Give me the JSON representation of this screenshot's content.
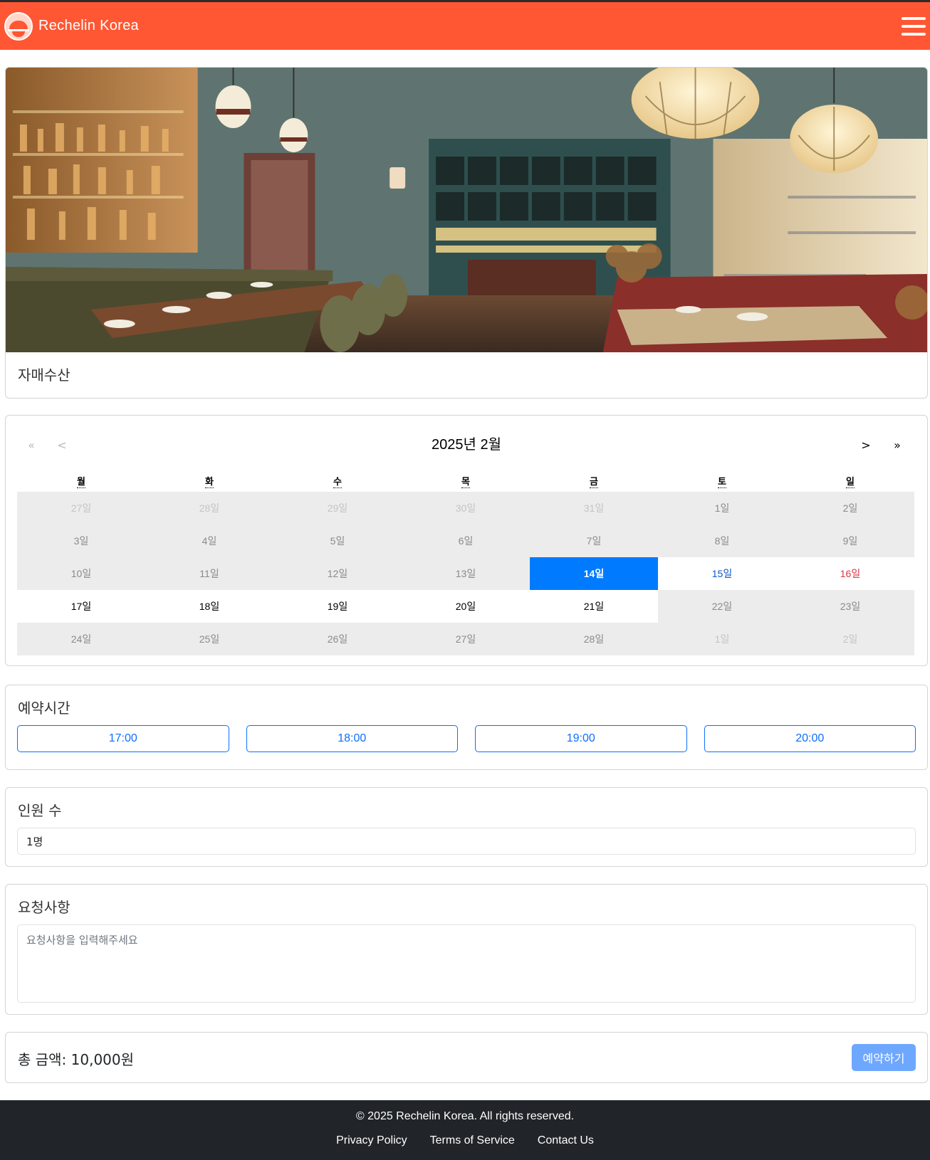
{
  "navbar": {
    "brand": "Rechelin Korea",
    "logo_icon": "bowl-logo-icon",
    "menu_icon": "hamburger-icon",
    "background": "#ff5733"
  },
  "restaurant": {
    "name": "자매수산"
  },
  "calendar": {
    "prev_year": "«",
    "prev_month": "<",
    "next_month": ">",
    "next_year": "»",
    "title": "2025년 2월",
    "weekdays": [
      "월",
      "화",
      "수",
      "목",
      "금",
      "토",
      "일"
    ],
    "days": [
      {
        "label": "27일",
        "state": "faint"
      },
      {
        "label": "28일",
        "state": "faint"
      },
      {
        "label": "29일",
        "state": "faint"
      },
      {
        "label": "30일",
        "state": "faint"
      },
      {
        "label": "31일",
        "state": "faint"
      },
      {
        "label": "1일",
        "state": "past"
      },
      {
        "label": "2일",
        "state": "past"
      },
      {
        "label": "3일",
        "state": "past"
      },
      {
        "label": "4일",
        "state": "past"
      },
      {
        "label": "5일",
        "state": "past"
      },
      {
        "label": "6일",
        "state": "past"
      },
      {
        "label": "7일",
        "state": "past"
      },
      {
        "label": "8일",
        "state": "past"
      },
      {
        "label": "9일",
        "state": "past"
      },
      {
        "label": "10일",
        "state": "past"
      },
      {
        "label": "11일",
        "state": "past"
      },
      {
        "label": "12일",
        "state": "past"
      },
      {
        "label": "13일",
        "state": "past"
      },
      {
        "label": "14일",
        "state": "selected"
      },
      {
        "label": "15일",
        "state": "avail-sat"
      },
      {
        "label": "16일",
        "state": "avail-sun"
      },
      {
        "label": "17일",
        "state": "avail"
      },
      {
        "label": "18일",
        "state": "avail"
      },
      {
        "label": "19일",
        "state": "avail"
      },
      {
        "label": "20일",
        "state": "avail"
      },
      {
        "label": "21일",
        "state": "avail"
      },
      {
        "label": "22일",
        "state": "past"
      },
      {
        "label": "23일",
        "state": "past"
      },
      {
        "label": "24일",
        "state": "past"
      },
      {
        "label": "25일",
        "state": "past"
      },
      {
        "label": "26일",
        "state": "past"
      },
      {
        "label": "27일",
        "state": "past"
      },
      {
        "label": "28일",
        "state": "past"
      },
      {
        "label": "1일",
        "state": "faint"
      },
      {
        "label": "2일",
        "state": "faint"
      }
    ],
    "selected_color": "#007bff"
  },
  "time": {
    "title": "예약시간",
    "slots": [
      "17:00",
      "18:00",
      "19:00",
      "20:00"
    ]
  },
  "people": {
    "title": "인원 수",
    "value": "1명"
  },
  "request": {
    "title": "요청사항",
    "placeholder": "요청사항을 입력해주세요"
  },
  "total": {
    "text": "총 금액: 10,000원",
    "button": "예약하기"
  },
  "footer": {
    "copyright": "© 2025 Rechelin Korea. All rights reserved.",
    "links": [
      "Privacy Policy",
      "Terms of Service",
      "Contact Us"
    ]
  }
}
